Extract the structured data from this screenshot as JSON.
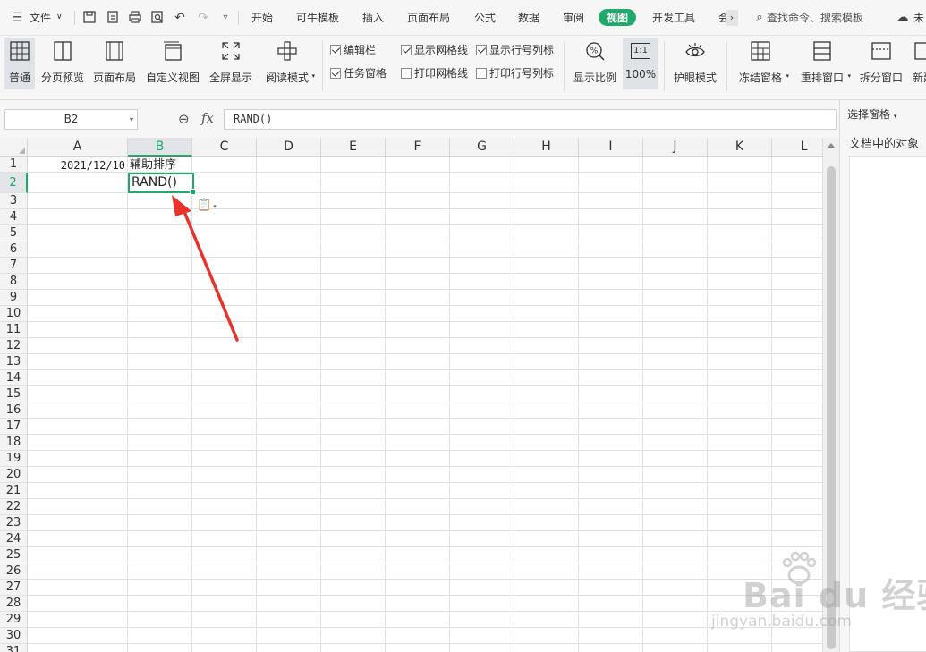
{
  "menubar": {
    "file_label": "文件",
    "tabs": [
      "开始",
      "可牛模板",
      "插入",
      "页面布局",
      "公式",
      "数据",
      "审阅",
      "视图",
      "开发工具",
      "会"
    ],
    "active_tab": "视图",
    "search_placeholder": "查找命令、搜索模板",
    "cloud_label": "未"
  },
  "ribbon": {
    "view_buttons": [
      "普通",
      "分页预览",
      "页面布局",
      "自定义视图",
      "全屏显示",
      "阅读模式"
    ],
    "checkboxes": [
      {
        "label": "编辑栏",
        "checked": true
      },
      {
        "label": "任务窗格",
        "checked": true
      },
      {
        "label": "显示网格线",
        "checked": true
      },
      {
        "label": "打印网格线",
        "checked": false
      },
      {
        "label": "显示行号列标",
        "checked": true
      },
      {
        "label": "打印行号列标",
        "checked": false
      }
    ],
    "zoom_label": "显示比例",
    "hundred_label": "100%",
    "hundred_icon": "1:1",
    "eye_label": "护眼模式",
    "freeze_label": "冻结窗格",
    "rearrange_label": "重排窗口",
    "split_label": "拆分窗口",
    "new_label": "新建"
  },
  "formula_bar": {
    "name_box": "B2",
    "fx": "fx",
    "formula": "RAND()"
  },
  "sheet": {
    "columns": [
      "A",
      "B",
      "C",
      "D",
      "E",
      "F",
      "G",
      "H",
      "I",
      "J",
      "K",
      "L"
    ],
    "rows": [
      "1",
      "2",
      "3",
      "4",
      "5",
      "6",
      "7",
      "8",
      "9",
      "10",
      "11",
      "12",
      "13",
      "14",
      "15",
      "16",
      "17",
      "18",
      "19",
      "20",
      "21",
      "22",
      "23",
      "24",
      "25",
      "26",
      "27",
      "28",
      "29",
      "30",
      "31"
    ],
    "selected_column": "B",
    "selected_row": "2",
    "cells": {
      "A1": "2021/12/10",
      "B1": "辅助排序",
      "B2": "RAND()"
    }
  },
  "task_pane": {
    "title": "选择窗格",
    "subtitle": "文档中的对象"
  },
  "watermark": {
    "main": "Bai du 经验",
    "sub": "jingyan.baidu.com"
  },
  "colors": {
    "accent": "#1faa6b",
    "arrow": "#e8322b"
  }
}
